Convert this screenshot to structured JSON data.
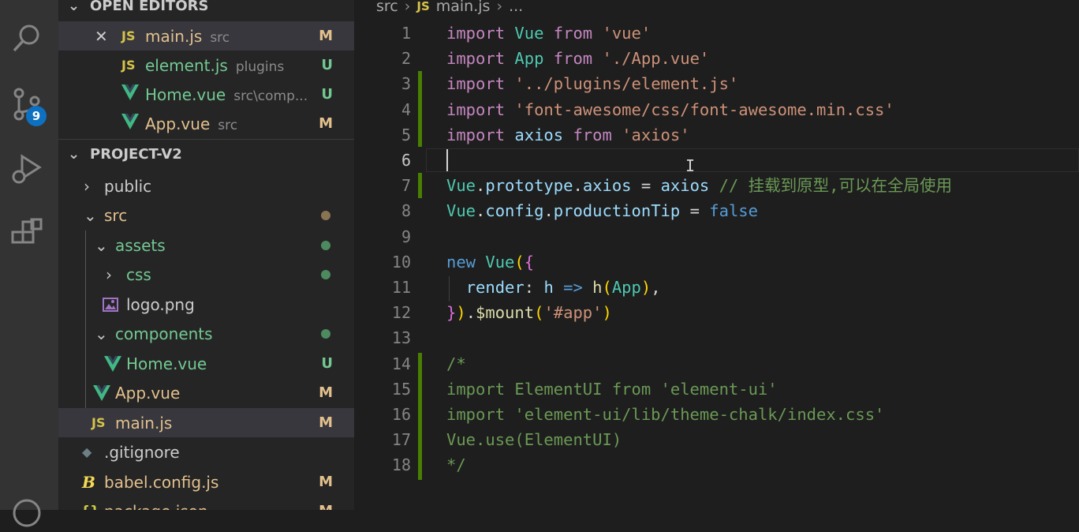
{
  "activity_bar": {
    "icons": [
      "search-icon",
      "source-control-icon",
      "run-debug-icon",
      "extensions-icon",
      "accounts-icon"
    ],
    "source_control_badge": "9"
  },
  "sidebar": {
    "open_editors": {
      "title": "OPEN EDITORS",
      "items": [
        {
          "icon": "js",
          "name": "main.js",
          "desc": "src",
          "status": "M",
          "selected": true,
          "close": "✕"
        },
        {
          "icon": "js",
          "name": "element.js",
          "desc": "plugins",
          "status": "U"
        },
        {
          "icon": "vue",
          "name": "Home.vue",
          "desc": "src\\comp...",
          "status": "U"
        },
        {
          "icon": "vue",
          "name": "App.vue",
          "desc": "src",
          "status": "M"
        }
      ]
    },
    "project": {
      "title": "PROJECT-V2",
      "items": [
        {
          "kind": "folder",
          "name": "public",
          "expanded": false
        },
        {
          "kind": "folder",
          "name": "src",
          "expanded": true
        },
        {
          "kind": "folder",
          "name": "assets",
          "expanded": true
        },
        {
          "kind": "folder",
          "name": "css",
          "expanded": false
        },
        {
          "kind": "image",
          "name": "logo.png"
        },
        {
          "kind": "folder",
          "name": "components",
          "expanded": true
        },
        {
          "kind": "vue",
          "name": "Home.vue",
          "status": "U"
        },
        {
          "kind": "vue",
          "name": "App.vue",
          "status": "M"
        },
        {
          "kind": "js",
          "name": "main.js",
          "status": "M"
        },
        {
          "kind": "git",
          "name": ".gitignore"
        },
        {
          "kind": "babel",
          "name": "babel.config.js",
          "status": "M"
        },
        {
          "kind": "json",
          "name": "package.json",
          "status": "M"
        }
      ]
    }
  },
  "editor": {
    "breadcrumb": {
      "folder": "src",
      "file": "main.js",
      "more": "..."
    },
    "line_numbers": [
      "1",
      "2",
      "3",
      "4",
      "5",
      "6",
      "7",
      "8",
      "9",
      "10",
      "11",
      "12",
      "13",
      "14",
      "15",
      "16",
      "17",
      "18"
    ],
    "lines": [
      "import Vue from 'vue'",
      "import App from './App.vue'",
      "import '../plugins/element.js'",
      "import 'font-awesome/css/font-awesome.min.css'",
      "import axios from 'axios'",
      "",
      "Vue.prototype.axios = axios // 挂载到原型,可以在全局使用",
      "Vue.config.productionTip = false",
      "",
      "new Vue({",
      "  render: h => h(App),",
      "}).$mount('#app')",
      "",
      "/*",
      "import ElementUI from 'element-ui'",
      "import 'element-ui/lib/theme-chalk/index.css'",
      "Vue.use(ElementUI)",
      "*/"
    ],
    "current_line": 6
  },
  "colors": {
    "status_modified": "#e2c08d",
    "status_untracked": "#73c991",
    "folder_modified_dot": "#8a7350",
    "folder_untracked_dot": "#4d8a60",
    "gutter_added": "#487e02"
  }
}
